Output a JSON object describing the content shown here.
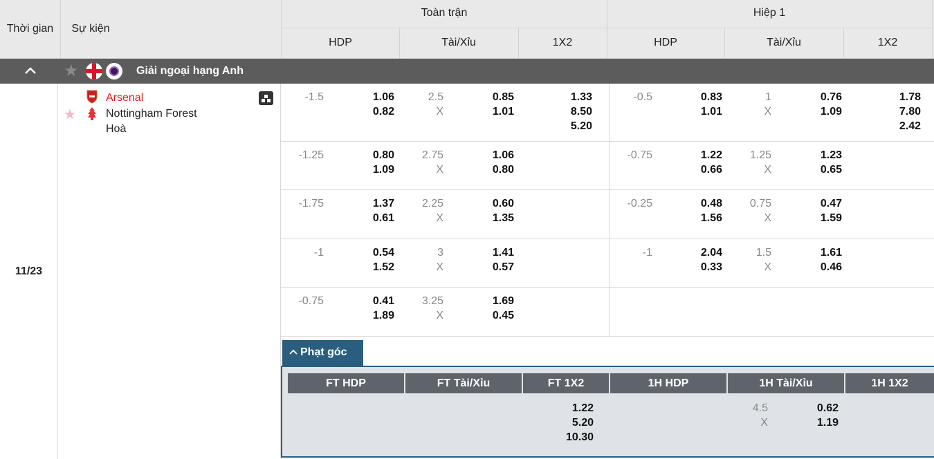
{
  "header": {
    "time": "Thời gian",
    "event": "Sự kiện",
    "full_match": "Toàn trận",
    "first_half": "Hiệp 1",
    "sub": [
      "HDP",
      "Tài/Xỉu",
      "1X2",
      "HDP",
      "Tài/Xỉu",
      "1X2"
    ]
  },
  "league": {
    "name": "Giải ngoại hạng Anh",
    "collapse_icon": "chevron-up-icon"
  },
  "match": {
    "time": "11/23",
    "home": "Arsenal",
    "away": "Nottingham Forest",
    "draw": "Hoà"
  },
  "rows": [
    {
      "ft_hdp": "-1.5",
      "ft_hdp_h": "1.06",
      "ft_hdp_a": "0.82",
      "ft_ou": "2.5",
      "ft_ou_x": "X",
      "ft_ou_o": "0.85",
      "ft_ou_u": "1.01",
      "ft_1": "1.33",
      "ft_2": "8.50",
      "ft_x": "5.20",
      "h1_hdp": "-0.5",
      "h1_hdp_h": "0.83",
      "h1_hdp_a": "1.01",
      "h1_ou": "1",
      "h1_ou_x": "X",
      "h1_ou_o": "0.76",
      "h1_ou_u": "1.09",
      "h1_1": "1.78",
      "h1_2": "7.80",
      "h1_x": "2.42"
    },
    {
      "ft_hdp": "-1.25",
      "ft_hdp_h": "0.80",
      "ft_hdp_a": "1.09",
      "ft_ou": "2.75",
      "ft_ou_x": "X",
      "ft_ou_o": "1.06",
      "ft_ou_u": "0.80",
      "h1_hdp": "-0.75",
      "h1_hdp_h": "1.22",
      "h1_hdp_a": "0.66",
      "h1_ou": "1.25",
      "h1_ou_x": "X",
      "h1_ou_o": "1.23",
      "h1_ou_u": "0.65"
    },
    {
      "ft_hdp": "-1.75",
      "ft_hdp_h": "1.37",
      "ft_hdp_a": "0.61",
      "ft_ou": "2.25",
      "ft_ou_x": "X",
      "ft_ou_o": "0.60",
      "ft_ou_u": "1.35",
      "h1_hdp": "-0.25",
      "h1_hdp_h": "0.48",
      "h1_hdp_a": "1.56",
      "h1_ou": "0.75",
      "h1_ou_x": "X",
      "h1_ou_o": "0.47",
      "h1_ou_u": "1.59"
    },
    {
      "ft_hdp": "-1",
      "ft_hdp_h": "0.54",
      "ft_hdp_a": "1.52",
      "ft_ou": "3",
      "ft_ou_x": "X",
      "ft_ou_o": "1.41",
      "ft_ou_u": "0.57",
      "h1_hdp": "-1",
      "h1_hdp_h": "2.04",
      "h1_hdp_a": "0.33",
      "h1_ou": "1.5",
      "h1_ou_x": "X",
      "h1_ou_o": "1.61",
      "h1_ou_u": "0.46"
    },
    {
      "ft_hdp": "-0.75",
      "ft_hdp_h": "0.41",
      "ft_hdp_a": "1.89",
      "ft_ou": "3.25",
      "ft_ou_x": "X",
      "ft_ou_o": "1.69",
      "ft_ou_u": "0.45"
    }
  ],
  "corners": {
    "tab": "Phạt góc",
    "headers": [
      "FT HDP",
      "FT Tài/Xỉu",
      "FT 1X2",
      "1H HDP",
      "1H Tài/Xỉu",
      "1H 1X2"
    ],
    "ft_1x2": [
      "1.22",
      "5.20",
      "10.30"
    ],
    "h1_ou_line": "4.5",
    "h1_ou_x": "X",
    "h1_ou_o": "0.62",
    "h1_ou_u": "1.19"
  }
}
